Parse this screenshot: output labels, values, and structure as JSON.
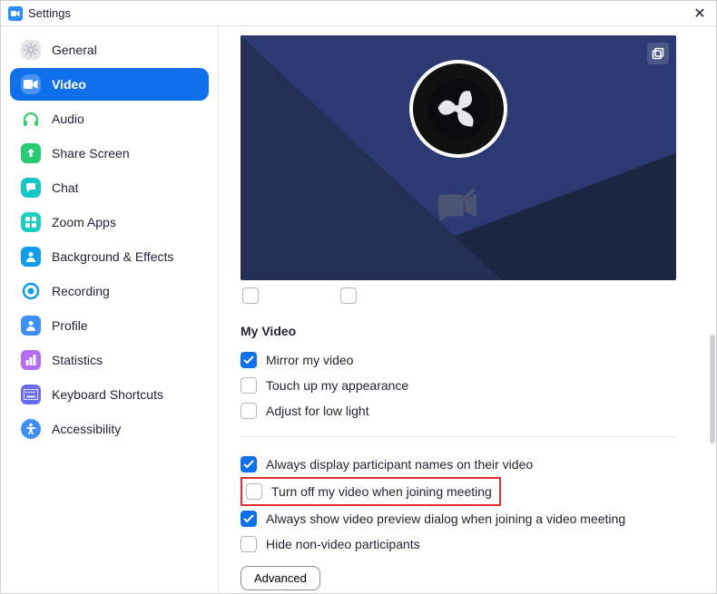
{
  "window": {
    "title": "Settings"
  },
  "sidebar": {
    "items": [
      {
        "id": "general",
        "label": "General"
      },
      {
        "id": "video",
        "label": "Video"
      },
      {
        "id": "audio",
        "label": "Audio"
      },
      {
        "id": "share-screen",
        "label": "Share Screen"
      },
      {
        "id": "chat",
        "label": "Chat"
      },
      {
        "id": "zoom-apps",
        "label": "Zoom Apps"
      },
      {
        "id": "background-effects",
        "label": "Background & Effects"
      },
      {
        "id": "recording",
        "label": "Recording"
      },
      {
        "id": "profile",
        "label": "Profile"
      },
      {
        "id": "statistics",
        "label": "Statistics"
      },
      {
        "id": "keyboard-shortcuts",
        "label": "Keyboard Shortcuts"
      },
      {
        "id": "accessibility",
        "label": "Accessibility"
      }
    ],
    "active_id": "video"
  },
  "panel": {
    "section_title": "My Video",
    "options_a": [
      {
        "label": "Mirror my video",
        "checked": true
      },
      {
        "label": "Touch up my appearance",
        "checked": false
      },
      {
        "label": "Adjust for low light",
        "checked": false
      }
    ],
    "options_b": [
      {
        "label": "Always display participant names on their video",
        "checked": true,
        "highlight": false
      },
      {
        "label": "Turn off my video when joining meeting",
        "checked": false,
        "highlight": true
      },
      {
        "label": "Always show video preview dialog when joining a video meeting",
        "checked": true,
        "highlight": false
      },
      {
        "label": "Hide non-video participants",
        "checked": false,
        "highlight": false
      }
    ],
    "advanced_label": "Advanced"
  },
  "colors": {
    "accent": "#0E71EB",
    "highlight_border": "#e03030"
  },
  "icons": {
    "general": "gear",
    "video": "camera",
    "audio": "headphones",
    "share-screen": "share",
    "chat": "chat-bubble",
    "zoom-apps": "apps",
    "background-effects": "person",
    "recording": "record",
    "profile": "profile",
    "statistics": "bars",
    "keyboard-shortcuts": "keyboard",
    "accessibility": "accessibility"
  }
}
